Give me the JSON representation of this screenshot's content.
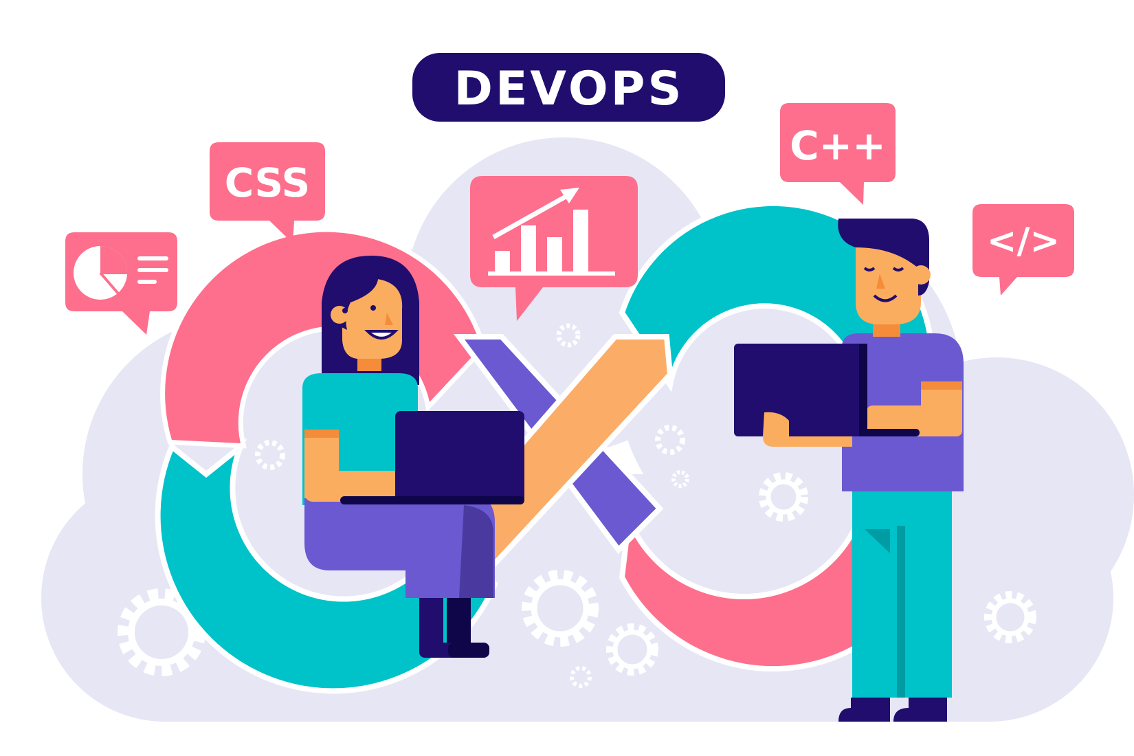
{
  "title": "DEVOPS",
  "bubbles": {
    "css": "CSS",
    "cpp": "C++",
    "code": "</>"
  },
  "icons": {
    "pie_chart": "pie-chart-icon",
    "bar_chart": "growth-chart-icon",
    "gear": "gear-icon",
    "laptop": "laptop-icon",
    "infinity": "infinity-loop"
  },
  "colors": {
    "background_cloud": "#e6e6f5",
    "navy": "#200d6e",
    "pink": "#fd6f8c",
    "teal": "#00c2c9",
    "purple": "#6a59d1",
    "orange": "#fbac66",
    "skin": "#fbad5f"
  }
}
